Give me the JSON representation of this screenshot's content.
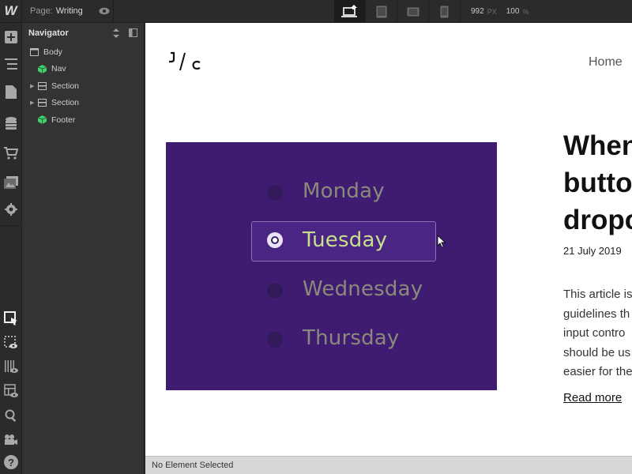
{
  "topbar": {
    "logo": "W",
    "page_label": "Page:",
    "page_name": "Writing",
    "width_value": "992",
    "width_unit": "PX",
    "zoom_value": "100",
    "zoom_unit": "%"
  },
  "navigator": {
    "title": "Navigator",
    "tree": [
      {
        "label": "Body",
        "type": "body",
        "expandable": false
      },
      {
        "label": "Nav",
        "type": "symbol",
        "expandable": false
      },
      {
        "label": "Section",
        "type": "section",
        "expandable": true
      },
      {
        "label": "Section",
        "type": "section",
        "expandable": true
      },
      {
        "label": "Footer",
        "type": "symbol",
        "expandable": false
      }
    ]
  },
  "site": {
    "logo_text": "J/C",
    "nav_home": "Home",
    "image": {
      "days": [
        "Monday",
        "Tuesday",
        "Wednesday",
        "Thursday"
      ],
      "selected_day": "Tuesday",
      "background": "#3f1c72",
      "selected_color": "#c8e08c"
    },
    "article": {
      "title_lines": [
        "When",
        "butto",
        "dropc"
      ],
      "date": "21  July 2019",
      "body_lines": [
        "This article is",
        "guidelines th",
        "input contro",
        "should be us",
        "easier for the"
      ],
      "read_more": "Read more"
    }
  },
  "status": {
    "text": "No Element Selected"
  }
}
